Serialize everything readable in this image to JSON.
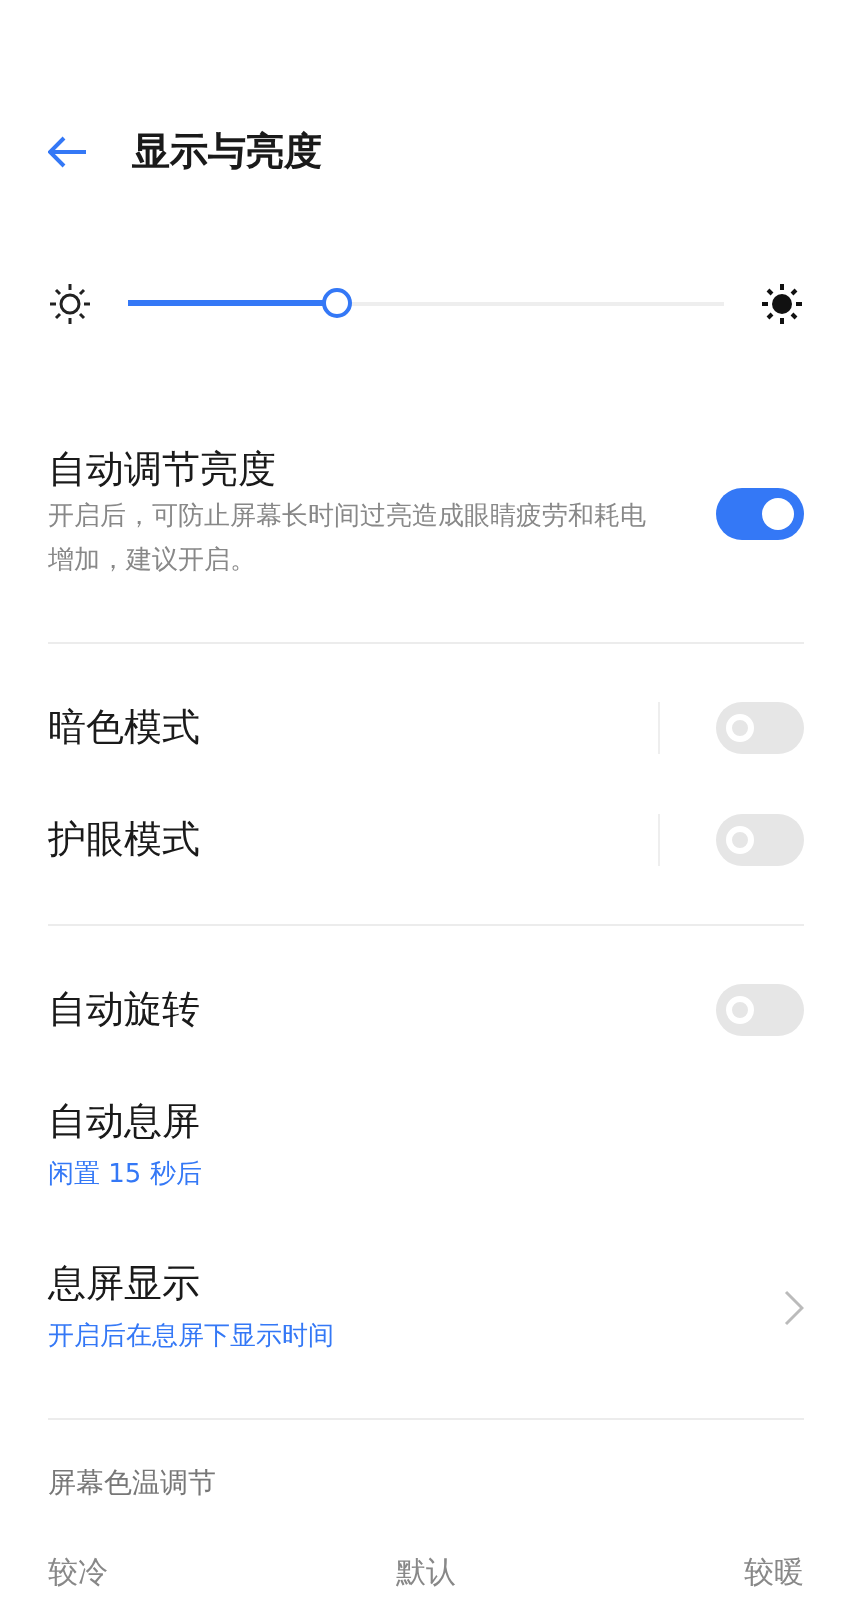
{
  "header": {
    "title": "显示与亮度"
  },
  "brightness": {
    "level": 0.35
  },
  "groups": [
    [
      {
        "kind": "toggle",
        "label": "自动调节亮度",
        "description": "开启后，可防止屏幕长时间过亮造成眼睛疲劳和耗电增加，建议开启。",
        "on": true
      }
    ],
    [
      {
        "kind": "split_toggle",
        "label": "暗色模式",
        "on": false
      },
      {
        "kind": "split_toggle",
        "label": "护眼模式",
        "on": false
      }
    ],
    [
      {
        "kind": "toggle",
        "label": "自动旋转",
        "on": false
      },
      {
        "kind": "value",
        "label": "自动息屏",
        "value": "闲置 15 秒后"
      },
      {
        "kind": "chevron",
        "label": "息屏显示",
        "value": "开启后在息屏下显示时间"
      }
    ]
  ],
  "color_temperature": {
    "title": "屏幕色温调节",
    "labels": [
      "较冷",
      "默认",
      "较暖"
    ]
  }
}
